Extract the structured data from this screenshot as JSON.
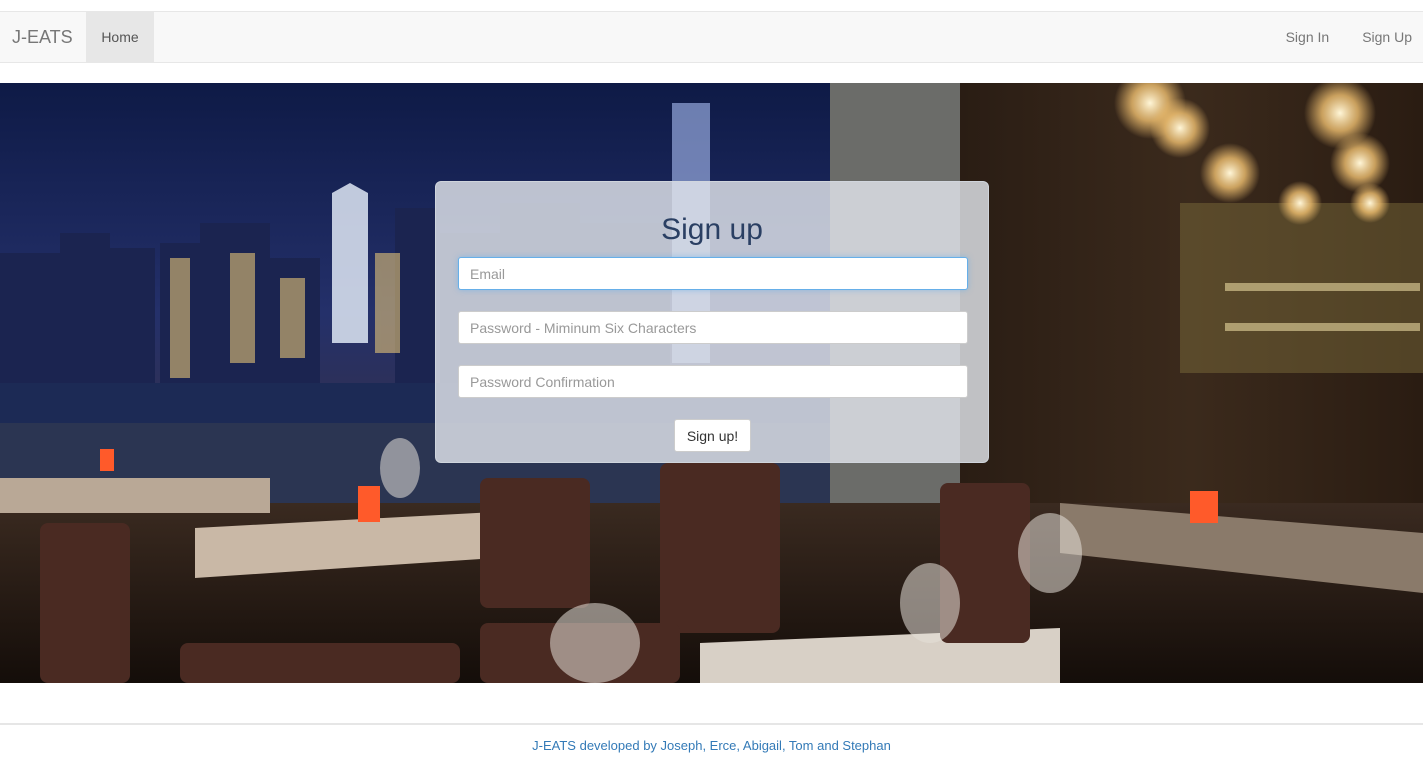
{
  "navbar": {
    "brand": "J-EATS",
    "home_label": "Home",
    "sign_in_label": "Sign In",
    "sign_up_label": "Sign Up"
  },
  "form": {
    "title": "Sign up",
    "email_placeholder": "Email",
    "password_placeholder": "Password - Miminum Six Characters",
    "confirmation_placeholder": "Password Confirmation",
    "submit_label": "Sign up!"
  },
  "footer": {
    "credit": "J-EATS developed by Joseph, Erce, Abigail, Tom and Stephan"
  },
  "colors": {
    "title": "#2a3f63",
    "footer_link": "#337ab7",
    "focus_border": "#66afe9"
  }
}
